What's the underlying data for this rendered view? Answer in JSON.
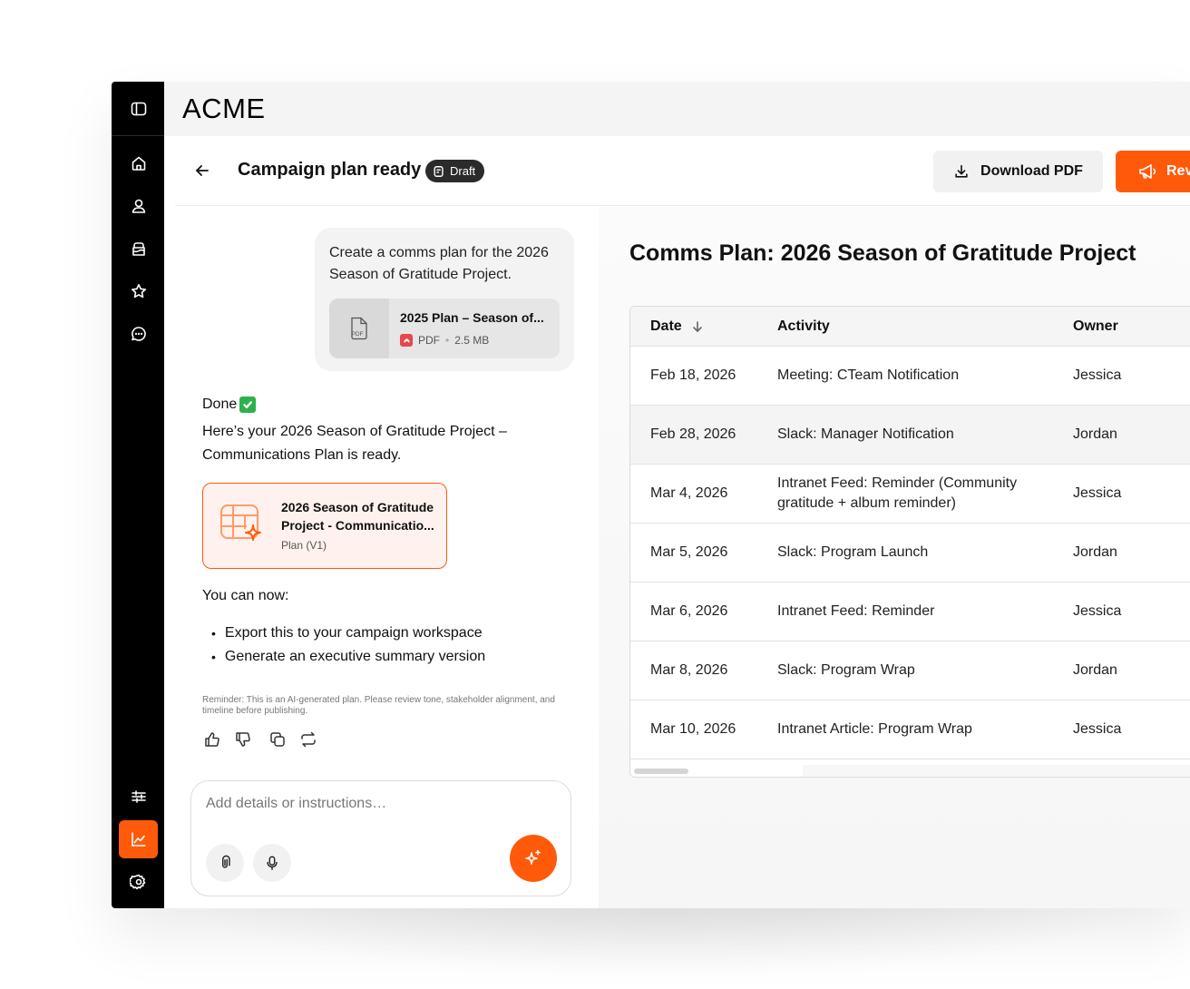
{
  "app": {
    "brand": "ACME"
  },
  "header": {
    "title": "Campaign plan ready",
    "badge": "Draft",
    "download_label": "Download PDF",
    "review_label": "Rev"
  },
  "chat": {
    "user_message": "Create a comms plan for the 2026 Season of Gratitude Project.",
    "attachment": {
      "name": "2025 Plan – Season of...",
      "type": "PDF",
      "size": "2.5 MB",
      "icon_label": "PDF"
    },
    "done_label": "Done",
    "reply_text": "Here’s your 2026 Season of Gratitude Project – Communications Plan is ready.",
    "plan_card": {
      "title_line1": "2026 Season of Gratitude",
      "title_line2": "Project - Communicatio...",
      "subtitle": "Plan (V1)"
    },
    "can_now": "You can now:",
    "options": [
      "Export this to your campaign workspace",
      "Generate an executive summary version"
    ],
    "reminder": "Reminder: This is an AI-generated plan. Please review tone, stakeholder alignment, and timeline before publishing.",
    "composer_placeholder": "Add details or instructions…"
  },
  "doc": {
    "title": "Comms Plan: 2026 Season of Gratitude Project",
    "columns": [
      "Date",
      "Activity",
      "Owner"
    ],
    "rows": [
      {
        "date": "Feb 18, 2026",
        "activity": "Meeting: CTeam Notification",
        "owner": "Jessica"
      },
      {
        "date": "Feb 28, 2026",
        "activity": "Slack: Manager Notification",
        "owner": "Jordan"
      },
      {
        "date": "Mar 4, 2026",
        "activity": "Intranet Feed: Reminder (Community gratitude + album reminder)",
        "owner": "Jessica"
      },
      {
        "date": "Mar 5, 2026",
        "activity": "Slack: Program Launch",
        "owner": "Jordan"
      },
      {
        "date": "Mar 6, 2026",
        "activity": "Intranet Feed: Reminder",
        "owner": "Jessica"
      },
      {
        "date": "Mar 8, 2026",
        "activity": "Slack: Program Wrap",
        "owner": "Jordan"
      },
      {
        "date": "Mar 10, 2026",
        "activity": "Intranet Article: Program Wrap",
        "owner": "Jessica"
      }
    ]
  },
  "colors": {
    "accent": "#FF5A0A",
    "rail": "#000000",
    "success": "#2BB24C",
    "pdf": "#E5484D"
  },
  "icons": {
    "rail": [
      "sidebar-toggle-icon",
      "home-icon",
      "user-icon",
      "cake-icon",
      "star-icon",
      "chat-icon",
      "sliders-icon",
      "chart-icon",
      "gear-icon"
    ]
  }
}
